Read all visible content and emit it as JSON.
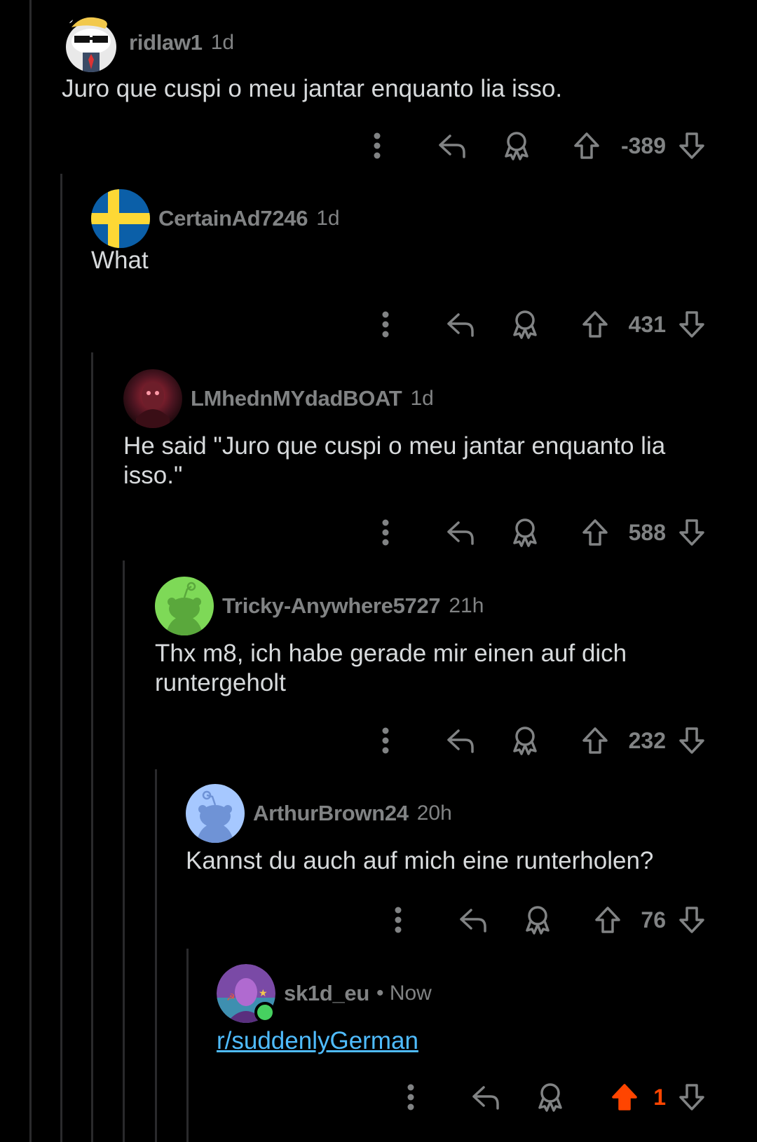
{
  "comments": [
    {
      "username": "ridlaw1",
      "time": "1d",
      "text": "Juro que cuspi o meu jantar enquanto lia isso.",
      "votes": "-389"
    },
    {
      "username": "CertainAd7246",
      "time": "1d",
      "text": "What",
      "votes": "431"
    },
    {
      "username": "LMhednMYdadBOAT",
      "time": "1d",
      "text": "He said \"Juro que cuspi o meu jantar enquanto lia isso.\"",
      "votes": "588"
    },
    {
      "username": "Tricky-Anywhere5727",
      "time": "21h",
      "text": "Thx m8, ich habe gerade mir einen auf dich runtergeholt",
      "votes": "232"
    },
    {
      "username": "ArthurBrown24",
      "time": "20h",
      "text": "Kannst du auch auf mich eine runterholen?",
      "votes": "76"
    },
    {
      "username": "sk1d_eu",
      "time": "• Now",
      "link": "r/suddenlyGerman",
      "votes": "1",
      "upvoted": true
    }
  ],
  "colors": {
    "background": "#000000",
    "muted": "#818384",
    "text": "#d7dadc",
    "link": "#4fbcff",
    "upvote": "#ff4500",
    "online": "#46d160"
  },
  "icons": [
    "more-options-icon",
    "reply-icon",
    "award-icon",
    "upvote-icon",
    "downvote-icon"
  ]
}
